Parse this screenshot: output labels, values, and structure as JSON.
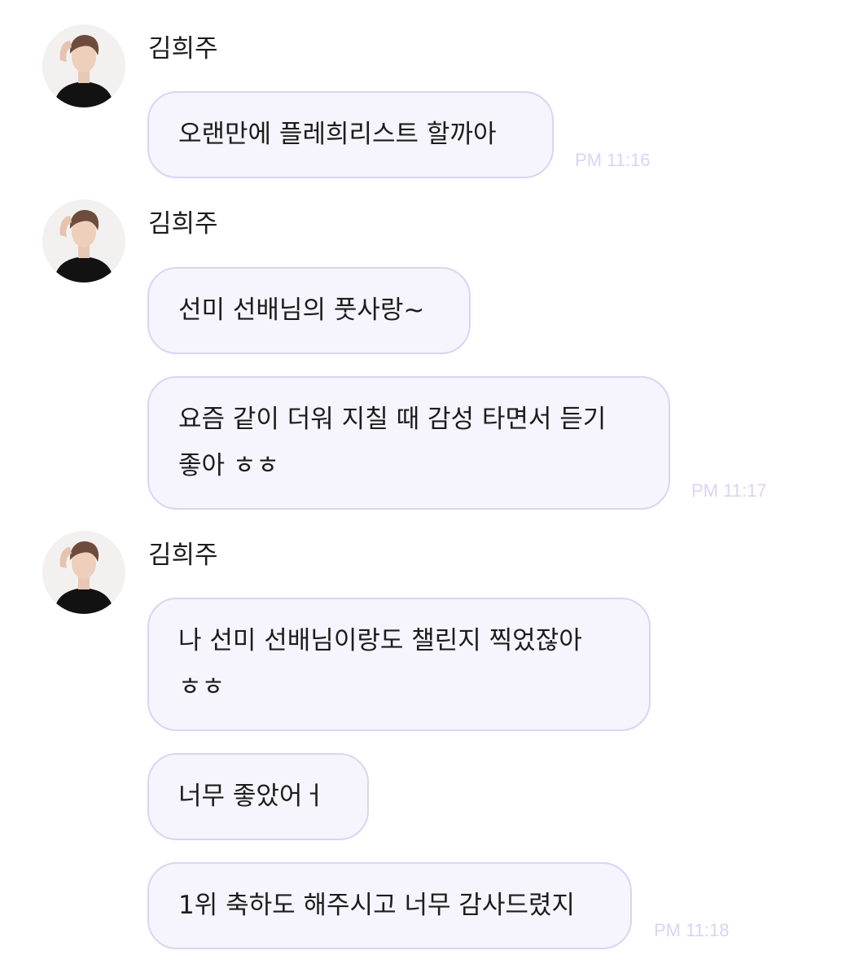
{
  "colors": {
    "bubble_background": "#f6f4fc",
    "bubble_border": "#ddd3f3",
    "timestamp": "#ddd2f3",
    "background": "#ffffff"
  },
  "groups": [
    {
      "sender": "김희주",
      "avatar_icon": "profile-photo",
      "messages": [
        "오랜만에 플레희리스트 할까아"
      ],
      "time": "PM 11:16"
    },
    {
      "sender": "김희주",
      "avatar_icon": "profile-photo",
      "messages": [
        "선미 선배님의 풋사랑~",
        "요즘 같이 더워 지칠 때 감성 타면서 듣기\n좋아 ㅎㅎ"
      ],
      "time": "PM 11:17"
    },
    {
      "sender": "김희주",
      "avatar_icon": "profile-photo",
      "messages": [
        "나 선미 선배님이랑도 챌린지 찍었잖아\nㅎㅎ",
        "너무 좋았어ㅓ",
        "1위 축하도 해주시고 너무 감사드렸지"
      ],
      "time": "PM 11:18"
    }
  ]
}
